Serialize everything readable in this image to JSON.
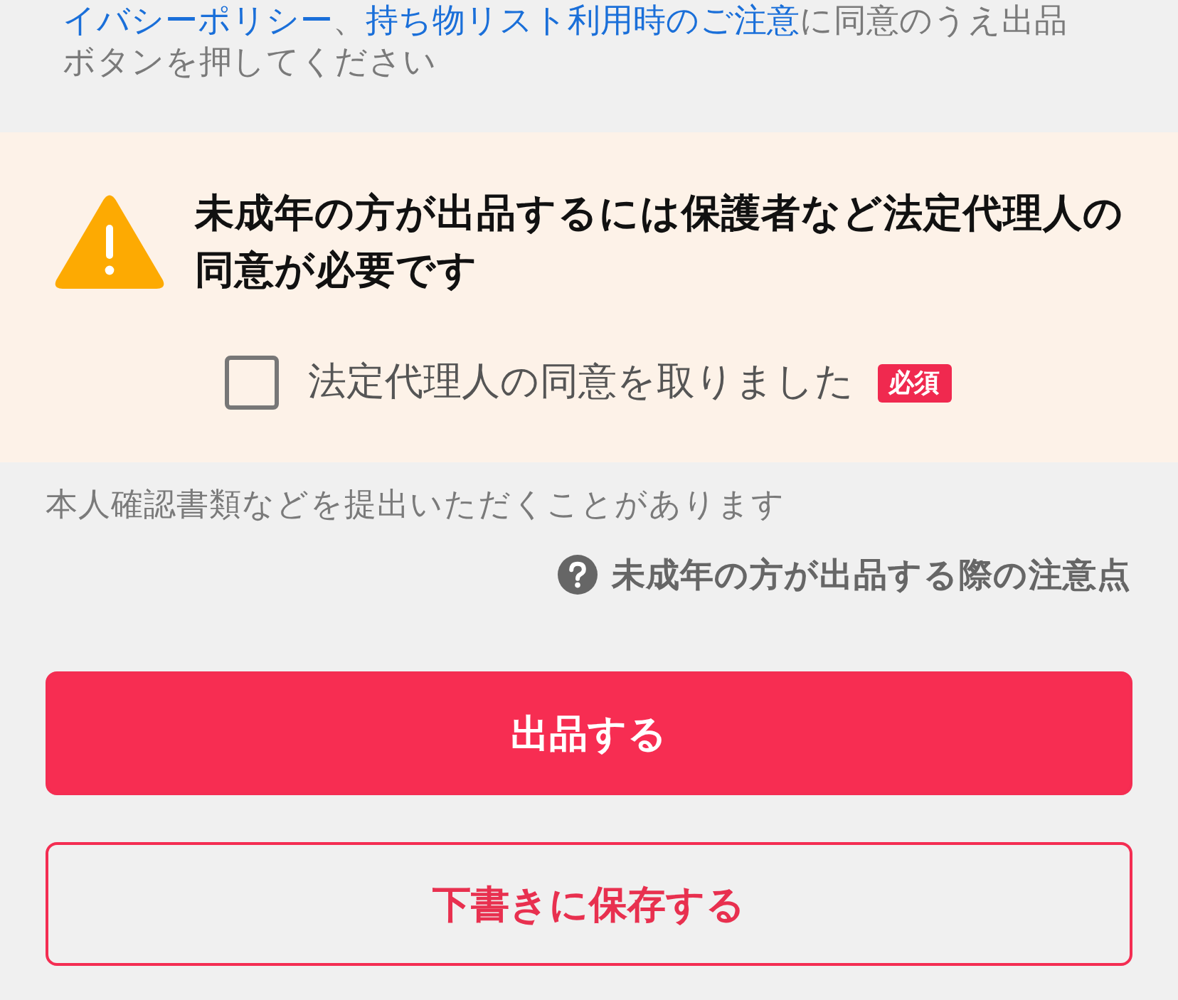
{
  "notice": {
    "segments": [
      {
        "kind": "link",
        "text": "イバシーポリシー"
      },
      {
        "kind": "text",
        "text": "、"
      },
      {
        "kind": "link",
        "text": "持ち物リスト利用時のご注意"
      },
      {
        "kind": "text",
        "text": "に同意のうえ出品ボタンを押してください"
      }
    ]
  },
  "warning": {
    "title": "未成年の方が出品するには保護者など法定代理人の同意が必要です",
    "consent": {
      "label": "法定代理人の同意を取りました",
      "checked": false,
      "badge": "必須"
    }
  },
  "note": "本人確認書類などを提出いただくことがあります",
  "help_link": "未成年の方が出品する際の注意点",
  "buttons": [
    {
      "kind": "primary",
      "label": "出品する"
    },
    {
      "kind": "secondary",
      "label": "下書きに保存する"
    }
  ]
}
